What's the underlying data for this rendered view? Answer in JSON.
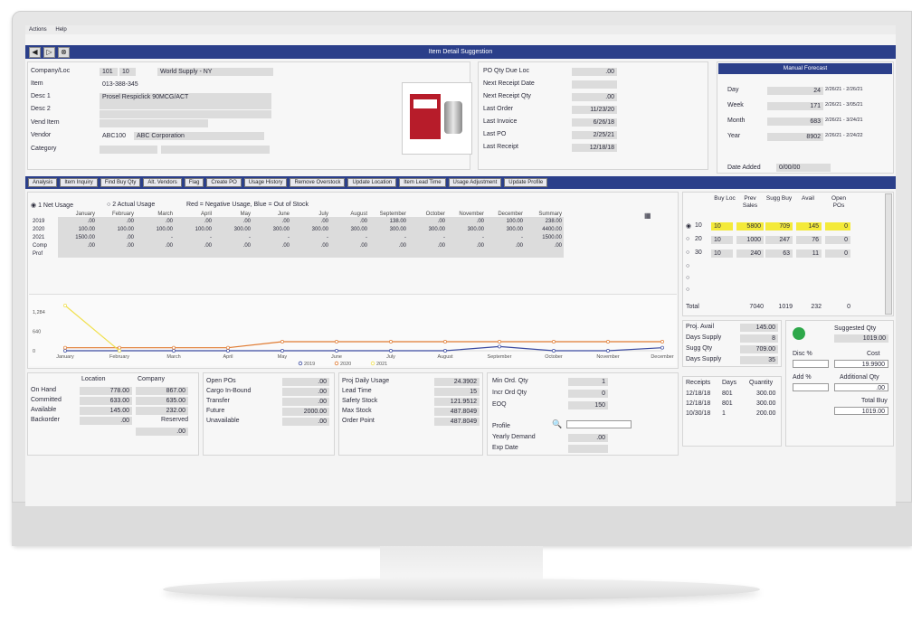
{
  "menu": {
    "actions": "Actions",
    "help": "Help"
  },
  "window": {
    "title": "Item Detail Suggestion"
  },
  "item": {
    "company_loc_label": "Company/Loc",
    "company_code": "101",
    "loc_code": "10",
    "company_name": "World Supply - NY",
    "item_label": "Item",
    "item_value": "013-388-345",
    "desc1_label": "Desc 1",
    "desc1_value": "Prosel Respiclick 90MCG/ACT",
    "desc2_label": "Desc 2",
    "vend_item_label": "Vend Item",
    "vendor_label": "Vendor",
    "vendor_code": "ABC100",
    "vendor_name": "ABC Corporation",
    "category_label": "Category"
  },
  "po": {
    "rows": [
      {
        "label": "PO Qty Due Loc",
        "value": ".00"
      },
      {
        "label": "Next Receipt Date",
        "value": ""
      },
      {
        "label": "Next Receipt Qty",
        "value": ".00"
      },
      {
        "label": "Last Order",
        "value": "11/23/20"
      },
      {
        "label": "Last Invoice",
        "value": "6/26/18"
      },
      {
        "label": "Last PO",
        "value": "2/25/21"
      },
      {
        "label": "Last Receipt",
        "value": "12/18/18"
      }
    ]
  },
  "manual_forecast": {
    "title": "Manual Forecast",
    "rows": [
      {
        "label": "Day",
        "value": "24",
        "range": "2/26/21 - 2/26/21"
      },
      {
        "label": "Week",
        "value": "171",
        "range": "2/26/21 - 3/05/21"
      },
      {
        "label": "Month",
        "value": "683",
        "range": "2/26/21 - 3/24/21"
      },
      {
        "label": "Year",
        "value": "8902",
        "range": "2/26/21 - 2/24/22"
      }
    ],
    "date_added_label": "Date Added",
    "date_added_value": "0/00/00"
  },
  "tabs": [
    "Analysis",
    "Item Inquiry",
    "Find Buy Qty",
    "Alt. Vendors",
    "Flag",
    "Create PO",
    "Usage History",
    "Remove Overstock",
    "Update Location",
    "Item Lead Time",
    "Usage Adjustment",
    "Update Profile"
  ],
  "usage": {
    "opt1": "1 Net Usage",
    "opt2": "2 Actual Usage",
    "legend_note": "Red = Negative Usage, Blue = Out of Stock",
    "months": [
      "January",
      "February",
      "March",
      "April",
      "May",
      "June",
      "July",
      "August",
      "September",
      "October",
      "November",
      "December",
      "Summary"
    ],
    "rows": [
      {
        "label": "2019",
        "vals": [
          ".00",
          ".00",
          ".00",
          ".00",
          ".00",
          ".00",
          ".00",
          ".00",
          "138.00",
          ".00",
          ".00",
          "100.00",
          "238.00"
        ]
      },
      {
        "label": "2020",
        "vals": [
          "100.00",
          "100.00",
          "100.00",
          "100.00",
          "300.00",
          "300.00",
          "300.00",
          "300.00",
          "300.00",
          "300.00",
          "300.00",
          "300.00",
          "4400.00"
        ]
      },
      {
        "label": "2021",
        "vals": [
          "1500.00",
          ".00",
          "-",
          "-",
          "-",
          "-",
          "-",
          "-",
          "-",
          "-",
          "-",
          "-",
          "1500.00"
        ]
      },
      {
        "label": "Comp",
        "vals": [
          ".00",
          ".00",
          ".00",
          ".00",
          ".00",
          ".00",
          ".00",
          ".00",
          ".00",
          ".00",
          ".00",
          ".00",
          ".00"
        ]
      },
      {
        "label": "Prof",
        "vals": [
          "",
          "",
          "",
          "",
          "",
          "",
          "",
          "",
          "",
          "",
          "",
          "",
          ""
        ]
      }
    ]
  },
  "chart_data": {
    "type": "line",
    "categories": [
      "January",
      "February",
      "March",
      "April",
      "May",
      "June",
      "July",
      "August",
      "September",
      "October",
      "November",
      "December"
    ],
    "ylim": [
      0,
      1500
    ],
    "yticks": [
      "1,284",
      "640",
      "0"
    ],
    "series": [
      {
        "name": "2019",
        "color": "#3a4aa0",
        "values": [
          0,
          0,
          0,
          0,
          0,
          0,
          0,
          0,
          138,
          0,
          0,
          100
        ]
      },
      {
        "name": "2020",
        "color": "#e07a30",
        "values": [
          100,
          100,
          100,
          100,
          300,
          300,
          300,
          300,
          300,
          300,
          300,
          300
        ]
      },
      {
        "name": "2021",
        "color": "#f0e050",
        "values": [
          1500,
          0,
          null,
          null,
          null,
          null,
          null,
          null,
          null,
          null,
          null,
          null
        ]
      }
    ]
  },
  "locs": {
    "headers": [
      "Buy Loc",
      "Prev Sales",
      "Sugg Buy",
      "Avail",
      "Open POs"
    ],
    "rows": [
      {
        "opt": "10",
        "buy": "10",
        "prev": "5800",
        "sugg": "709",
        "avail": "145",
        "open": "0",
        "sel": true
      },
      {
        "opt": "20",
        "buy": "10",
        "prev": "1000",
        "sugg": "247",
        "avail": "76",
        "open": "0",
        "sel": false
      },
      {
        "opt": "30",
        "buy": "10",
        "prev": "240",
        "sugg": "63",
        "avail": "11",
        "open": "0",
        "sel": false
      }
    ],
    "total_label": "Total",
    "total_prev": "7040",
    "total_sugg": "1019",
    "total_avail": "232",
    "total_open": "0"
  },
  "proj": {
    "rows": [
      {
        "label": "Proj. Avail",
        "value": "145.00"
      },
      {
        "label": "Days Supply",
        "value": "8"
      },
      {
        "label": "Sugg Qty",
        "value": "709.00"
      },
      {
        "label": "Days Supply",
        "value": "35"
      }
    ]
  },
  "suggested": {
    "sugg_qty_label": "Suggested Qty",
    "sugg_qty_value": "1019.00",
    "disc_label": "Disc %",
    "cost_label": "Cost",
    "cost_value": "19.9900",
    "add_label": "Add %",
    "addl_qty_label": "Additional Qty",
    "addl_qty_value": ".00",
    "total_buy_label": "Total Buy",
    "total_buy_value": "1019.00"
  },
  "onhand": {
    "loc_header": "Location",
    "comp_header": "Company",
    "rows": [
      {
        "label": "On Hand",
        "loc": "778.00",
        "comp": "867.00"
      },
      {
        "label": "Committed",
        "loc": "633.00",
        "comp": "635.00"
      },
      {
        "label": "Available",
        "loc": "145.00",
        "comp": "232.00"
      },
      {
        "label": "Backorder",
        "loc": ".00",
        "comp": "Reserved"
      }
    ],
    "reserved_value": ".00"
  },
  "openpo": {
    "rows": [
      {
        "label": "Open POs",
        "value": ".00"
      },
      {
        "label": "Cargo In-Bound",
        "value": ".00"
      },
      {
        "label": "Transfer",
        "value": ".00"
      },
      {
        "label": "Future",
        "value": "2000.00"
      },
      {
        "label": "Unavailable",
        "value": ".00"
      }
    ]
  },
  "daily": {
    "rows": [
      {
        "label": "Proj Daily Usage",
        "value": "24.3902"
      },
      {
        "label": "Lead Time",
        "value": "15"
      },
      {
        "label": "Safety Stock",
        "value": "121.9512"
      },
      {
        "label": "Max Stock",
        "value": "487.8049"
      },
      {
        "label": "Order Point",
        "value": "487.8049"
      }
    ]
  },
  "minord": {
    "rows": [
      {
        "label": "Min Ord. Qty",
        "value": "1"
      },
      {
        "label": "Incr Ord Qty",
        "value": "0"
      },
      {
        "label": "EOQ",
        "value": "150"
      }
    ],
    "profile_label": "Profile",
    "yearly_label": "Yearly Demand",
    "yearly_value": ".00",
    "exp_label": "Exp Date"
  },
  "receipts": {
    "headers": [
      "Receipts",
      "Days",
      "Quantity"
    ],
    "rows": [
      {
        "date": "12/18/18",
        "days": "801",
        "qty": "300.00"
      },
      {
        "date": "12/18/18",
        "days": "801",
        "qty": "300.00"
      },
      {
        "date": "10/30/18",
        "days": "1",
        "qty": "200.00"
      }
    ]
  },
  "colors": {
    "header_blue": "#2b3f8a",
    "highlight": "#f4ea3a",
    "status_green": "#2ea84a"
  }
}
